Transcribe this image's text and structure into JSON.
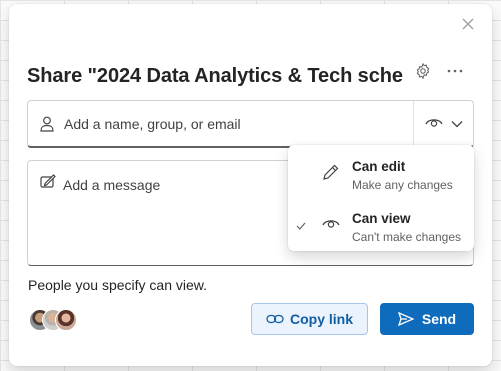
{
  "dialog": {
    "title": "Share \"2024 Data Analytics & Tech sche...",
    "close_icon": "close-icon",
    "settings_icon": "gear-icon",
    "more_icon": "more-horizontal-icon"
  },
  "recipients": {
    "placeholder": "Add a name, group, or email",
    "permission_icon": "eye-icon"
  },
  "message": {
    "placeholder": "Add a message"
  },
  "permission_menu": {
    "items": [
      {
        "title": "Can edit",
        "subtitle": "Make any changes",
        "icon": "pencil-icon",
        "selected": false
      },
      {
        "title": "Can view",
        "subtitle": "Can't make changes",
        "icon": "eye-icon",
        "selected": true
      }
    ]
  },
  "footer": {
    "info": "People you specify can view.",
    "copy_link_label": "Copy link",
    "send_label": "Send"
  },
  "colors": {
    "primary": "#0f6cbd",
    "secondary_bg": "#ebf3fc",
    "secondary_text": "#115ea3"
  }
}
